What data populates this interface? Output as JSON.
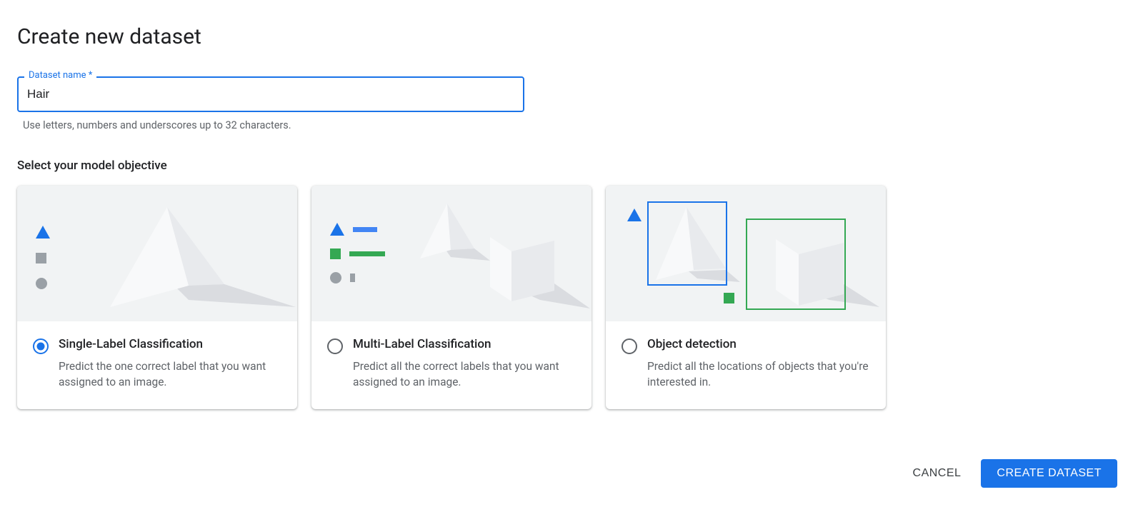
{
  "title": "Create new dataset",
  "datasetName": {
    "label": "Dataset name *",
    "value": "Hair",
    "helper": "Use letters, numbers and underscores up to 32 characters."
  },
  "objective": {
    "sectionLabel": "Select your model objective",
    "cards": [
      {
        "title": "Single-Label Classification",
        "desc": "Predict the one correct label that you want assigned to an image.",
        "selected": true
      },
      {
        "title": "Multi-Label Classification",
        "desc": "Predict all the correct labels that you want assigned to an image.",
        "selected": false
      },
      {
        "title": "Object detection",
        "desc": "Predict all the locations of objects that you're interested in.",
        "selected": false
      }
    ]
  },
  "buttons": {
    "cancel": "CANCEL",
    "create": "CREATE DATASET"
  }
}
